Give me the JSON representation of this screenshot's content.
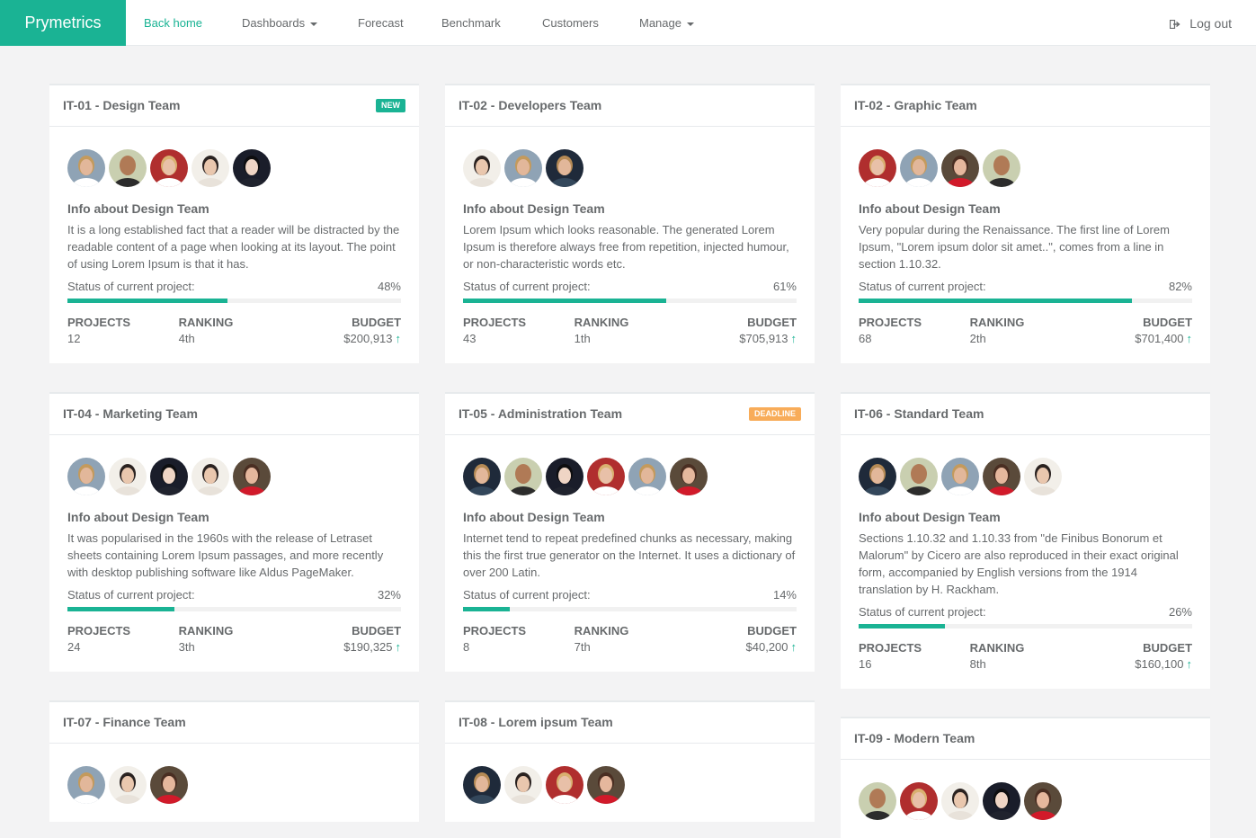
{
  "nav": {
    "brand": "Prymetrics",
    "links": [
      {
        "label": "Back home",
        "dropdown": false,
        "active": true
      },
      {
        "label": "Dashboards",
        "dropdown": true,
        "active": false
      },
      {
        "label": "Forecast",
        "dropdown": false,
        "active": false
      },
      {
        "label": "Benchmark",
        "dropdown": false,
        "active": false
      },
      {
        "label": "Customers",
        "dropdown": false,
        "active": false
      },
      {
        "label": "Manage",
        "dropdown": true,
        "active": false
      }
    ],
    "logout": "Log out",
    "logout_icon": "sign-out-icon"
  },
  "labels": {
    "info_title": "Info about Design Team",
    "status": "Status of current project:",
    "projects": "PROJECTS",
    "ranking": "RANKING",
    "budget": "BUDGET",
    "trend_icon": "arrow-up-icon"
  },
  "colors": {
    "accent": "#1ab394",
    "warning": "#f8ac59",
    "background": "#f3f3f4",
    "text": "#676a6c"
  },
  "teams": [
    {
      "title": "IT-01 - Design Team",
      "badge": "NEW",
      "badge_type": "new",
      "avatars": [
        "man-blond",
        "man-bald",
        "woman-curly",
        "woman-asian-light",
        "woman-asian-dark"
      ],
      "description": "It is a long established fact that a reader will be distracted by the readable content of a page when looking at its layout. The point of using Lorem Ipsum is that it has.",
      "progress": "48%",
      "progress_value": 48,
      "projects": "12",
      "ranking": "4th",
      "budget": "$200,913"
    },
    {
      "title": "IT-02 - Developers Team",
      "badge": "",
      "badge_type": "",
      "avatars": [
        "woman-asian-light",
        "man-blond",
        "man-blond-dark"
      ],
      "description": "Lorem Ipsum which looks reasonable. The generated Lorem Ipsum is therefore always free from repetition, injected humour, or non-characteristic words etc.",
      "progress": "61%",
      "progress_value": 61,
      "projects": "43",
      "ranking": "1th",
      "budget": "$705,913"
    },
    {
      "title": "IT-02 - Graphic Team",
      "badge": "",
      "badge_type": "",
      "avatars": [
        "woman-curly",
        "man-blond",
        "woman-red",
        "man-bald"
      ],
      "description": "Very popular during the Renaissance. The first line of Lorem Ipsum, \"Lorem ipsum dolor sit amet..\", comes from a line in section 1.10.32.",
      "progress": "82%",
      "progress_value": 82,
      "projects": "68",
      "ranking": "2th",
      "budget": "$701,400"
    },
    {
      "title": "IT-04 - Marketing Team",
      "badge": "",
      "badge_type": "",
      "avatars": [
        "man-blond",
        "woman-asian-light",
        "woman-asian-dark",
        "woman-asian-light",
        "woman-red"
      ],
      "description": "It was popularised in the 1960s with the release of Letraset sheets containing Lorem Ipsum passages, and more recently with desktop publishing software like Aldus PageMaker.",
      "progress": "32%",
      "progress_value": 32,
      "projects": "24",
      "ranking": "3th",
      "budget": "$190,325"
    },
    {
      "title": "IT-05 - Administration Team",
      "badge": "DEADLINE",
      "badge_type": "deadline",
      "avatars": [
        "man-blond-dark",
        "man-bald",
        "woman-asian-dark",
        "woman-curly",
        "man-blond",
        "woman-red"
      ],
      "description": "Internet tend to repeat predefined chunks as necessary, making this the first true generator on the Internet. It uses a dictionary of over 200 Latin.",
      "progress": "14%",
      "progress_value": 14,
      "projects": "8",
      "ranking": "7th",
      "budget": "$40,200"
    },
    {
      "title": "IT-06 - Standard Team",
      "badge": "",
      "badge_type": "",
      "avatars": [
        "man-blond-dark",
        "man-bald",
        "man-blond",
        "woman-red",
        "woman-asian-light"
      ],
      "description": "Sections 1.10.32 and 1.10.33 from \"de Finibus Bonorum et Malorum\" by Cicero are also reproduced in their exact original form, accompanied by English versions from the 1914 translation by H. Rackham.",
      "progress": "26%",
      "progress_value": 26,
      "projects": "16",
      "ranking": "8th",
      "budget": "$160,100"
    },
    {
      "title": "IT-07 - Finance Team",
      "badge": "",
      "badge_type": "",
      "avatars": [
        "man-blond",
        "woman-asian-light",
        "woman-red"
      ],
      "description": "",
      "progress": "",
      "progress_value": 0,
      "projects": "",
      "ranking": "",
      "budget": ""
    },
    {
      "title": "IT-08 - Lorem ipsum Team",
      "badge": "",
      "badge_type": "",
      "avatars": [
        "man-blond-dark",
        "woman-asian-light",
        "woman-curly",
        "woman-red"
      ],
      "description": "",
      "progress": "",
      "progress_value": 0,
      "projects": "",
      "ranking": "",
      "budget": ""
    },
    {
      "title": "IT-09 - Modern Team",
      "badge": "",
      "badge_type": "",
      "avatars": [
        "man-bald",
        "woman-curly",
        "woman-asian-light",
        "woman-asian-dark",
        "woman-red"
      ],
      "description": "",
      "progress": "",
      "progress_value": 0,
      "projects": "",
      "ranking": "",
      "budget": ""
    }
  ]
}
